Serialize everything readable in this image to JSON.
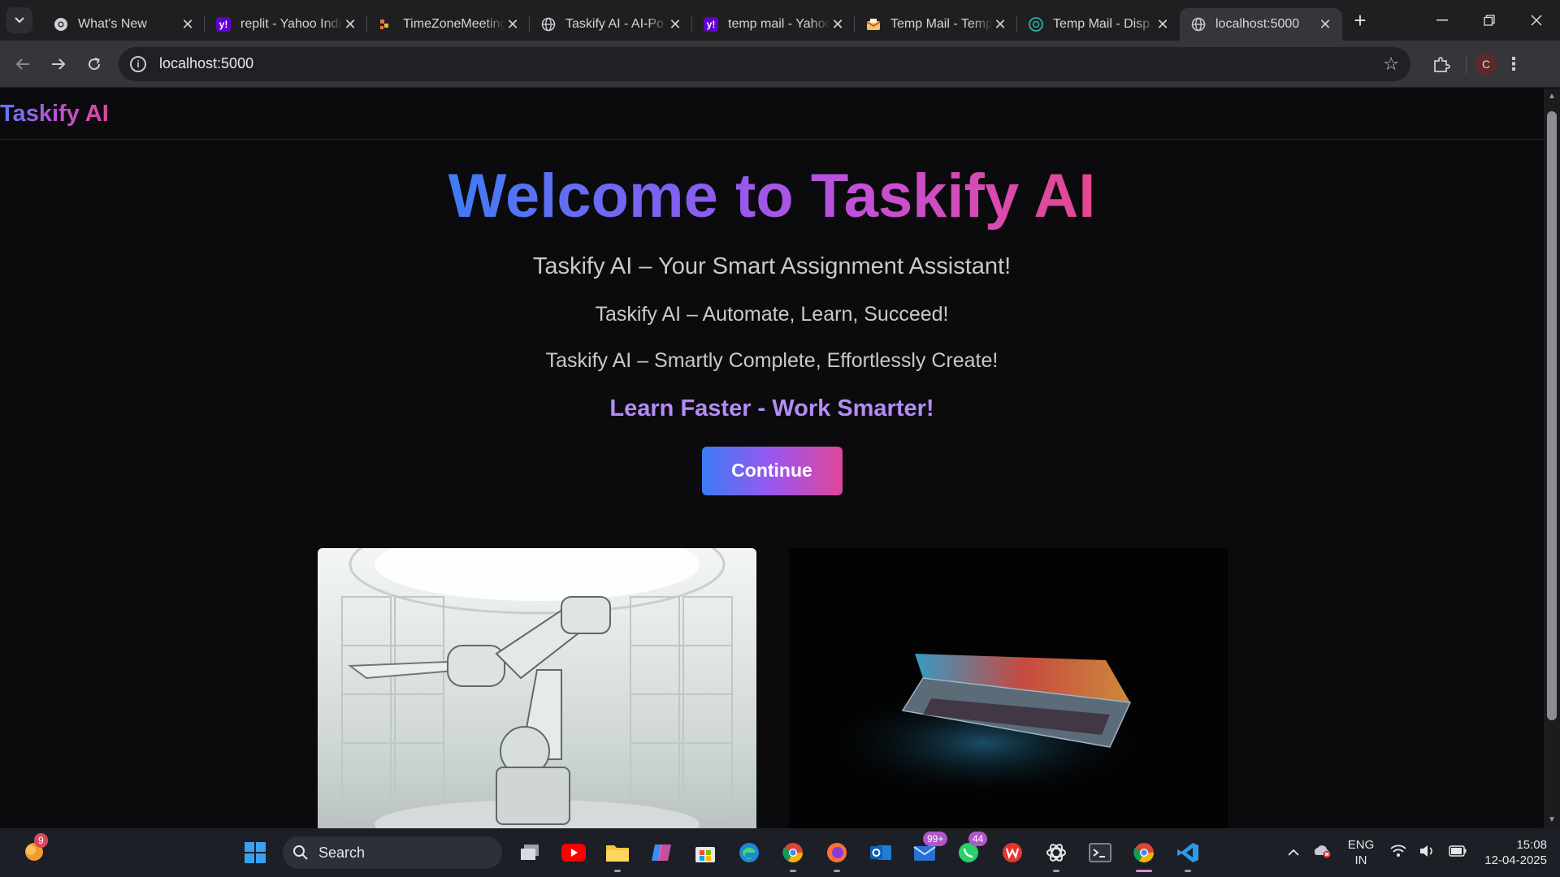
{
  "browser": {
    "tabs": [
      {
        "title": "What's New",
        "icon": "chrome-icon",
        "active": false
      },
      {
        "title": "replit - Yahoo India",
        "icon": "yahoo-icon",
        "active": false
      },
      {
        "title": "TimeZoneMeeting",
        "icon": "timezone-icon",
        "active": false
      },
      {
        "title": "Taskify AI - AI-Po",
        "icon": "globe-icon",
        "active": false
      },
      {
        "title": "temp mail - Yahoo",
        "icon": "yahoo-icon",
        "active": false
      },
      {
        "title": "Temp Mail - Temp",
        "icon": "mail-icon",
        "active": false
      },
      {
        "title": "Temp Mail - Disp",
        "icon": "tempmail-icon",
        "active": false
      },
      {
        "title": "localhost:5000",
        "icon": "globe-icon",
        "active": true
      }
    ],
    "url": "localhost:5000",
    "profile_initial": "C"
  },
  "page": {
    "brand": "Taskify AI",
    "title": "Welcome to Taskify AI",
    "tagline1": "Taskify AI – Your Smart Assignment Assistant!",
    "tagline2": "Taskify AI – Automate, Learn, Succeed!",
    "tagline3": "Taskify AI – Smartly Complete, Effortlessly Create!",
    "slogan": "Learn Faster - Work Smarter!",
    "cta": "Continue",
    "colors": {
      "gradient_start": "#3f7cf5",
      "gradient_mid": "#9a57ee",
      "gradient_end": "#e0459a",
      "slogan": "#b58cf4"
    }
  },
  "taskbar": {
    "search_label": "Search",
    "widget_badge": "9",
    "mail_badge": "99+",
    "whatsapp_badge": "44",
    "lang_top": "ENG",
    "lang_bottom": "IN",
    "time": "15:08",
    "date": "12-04-2025"
  }
}
